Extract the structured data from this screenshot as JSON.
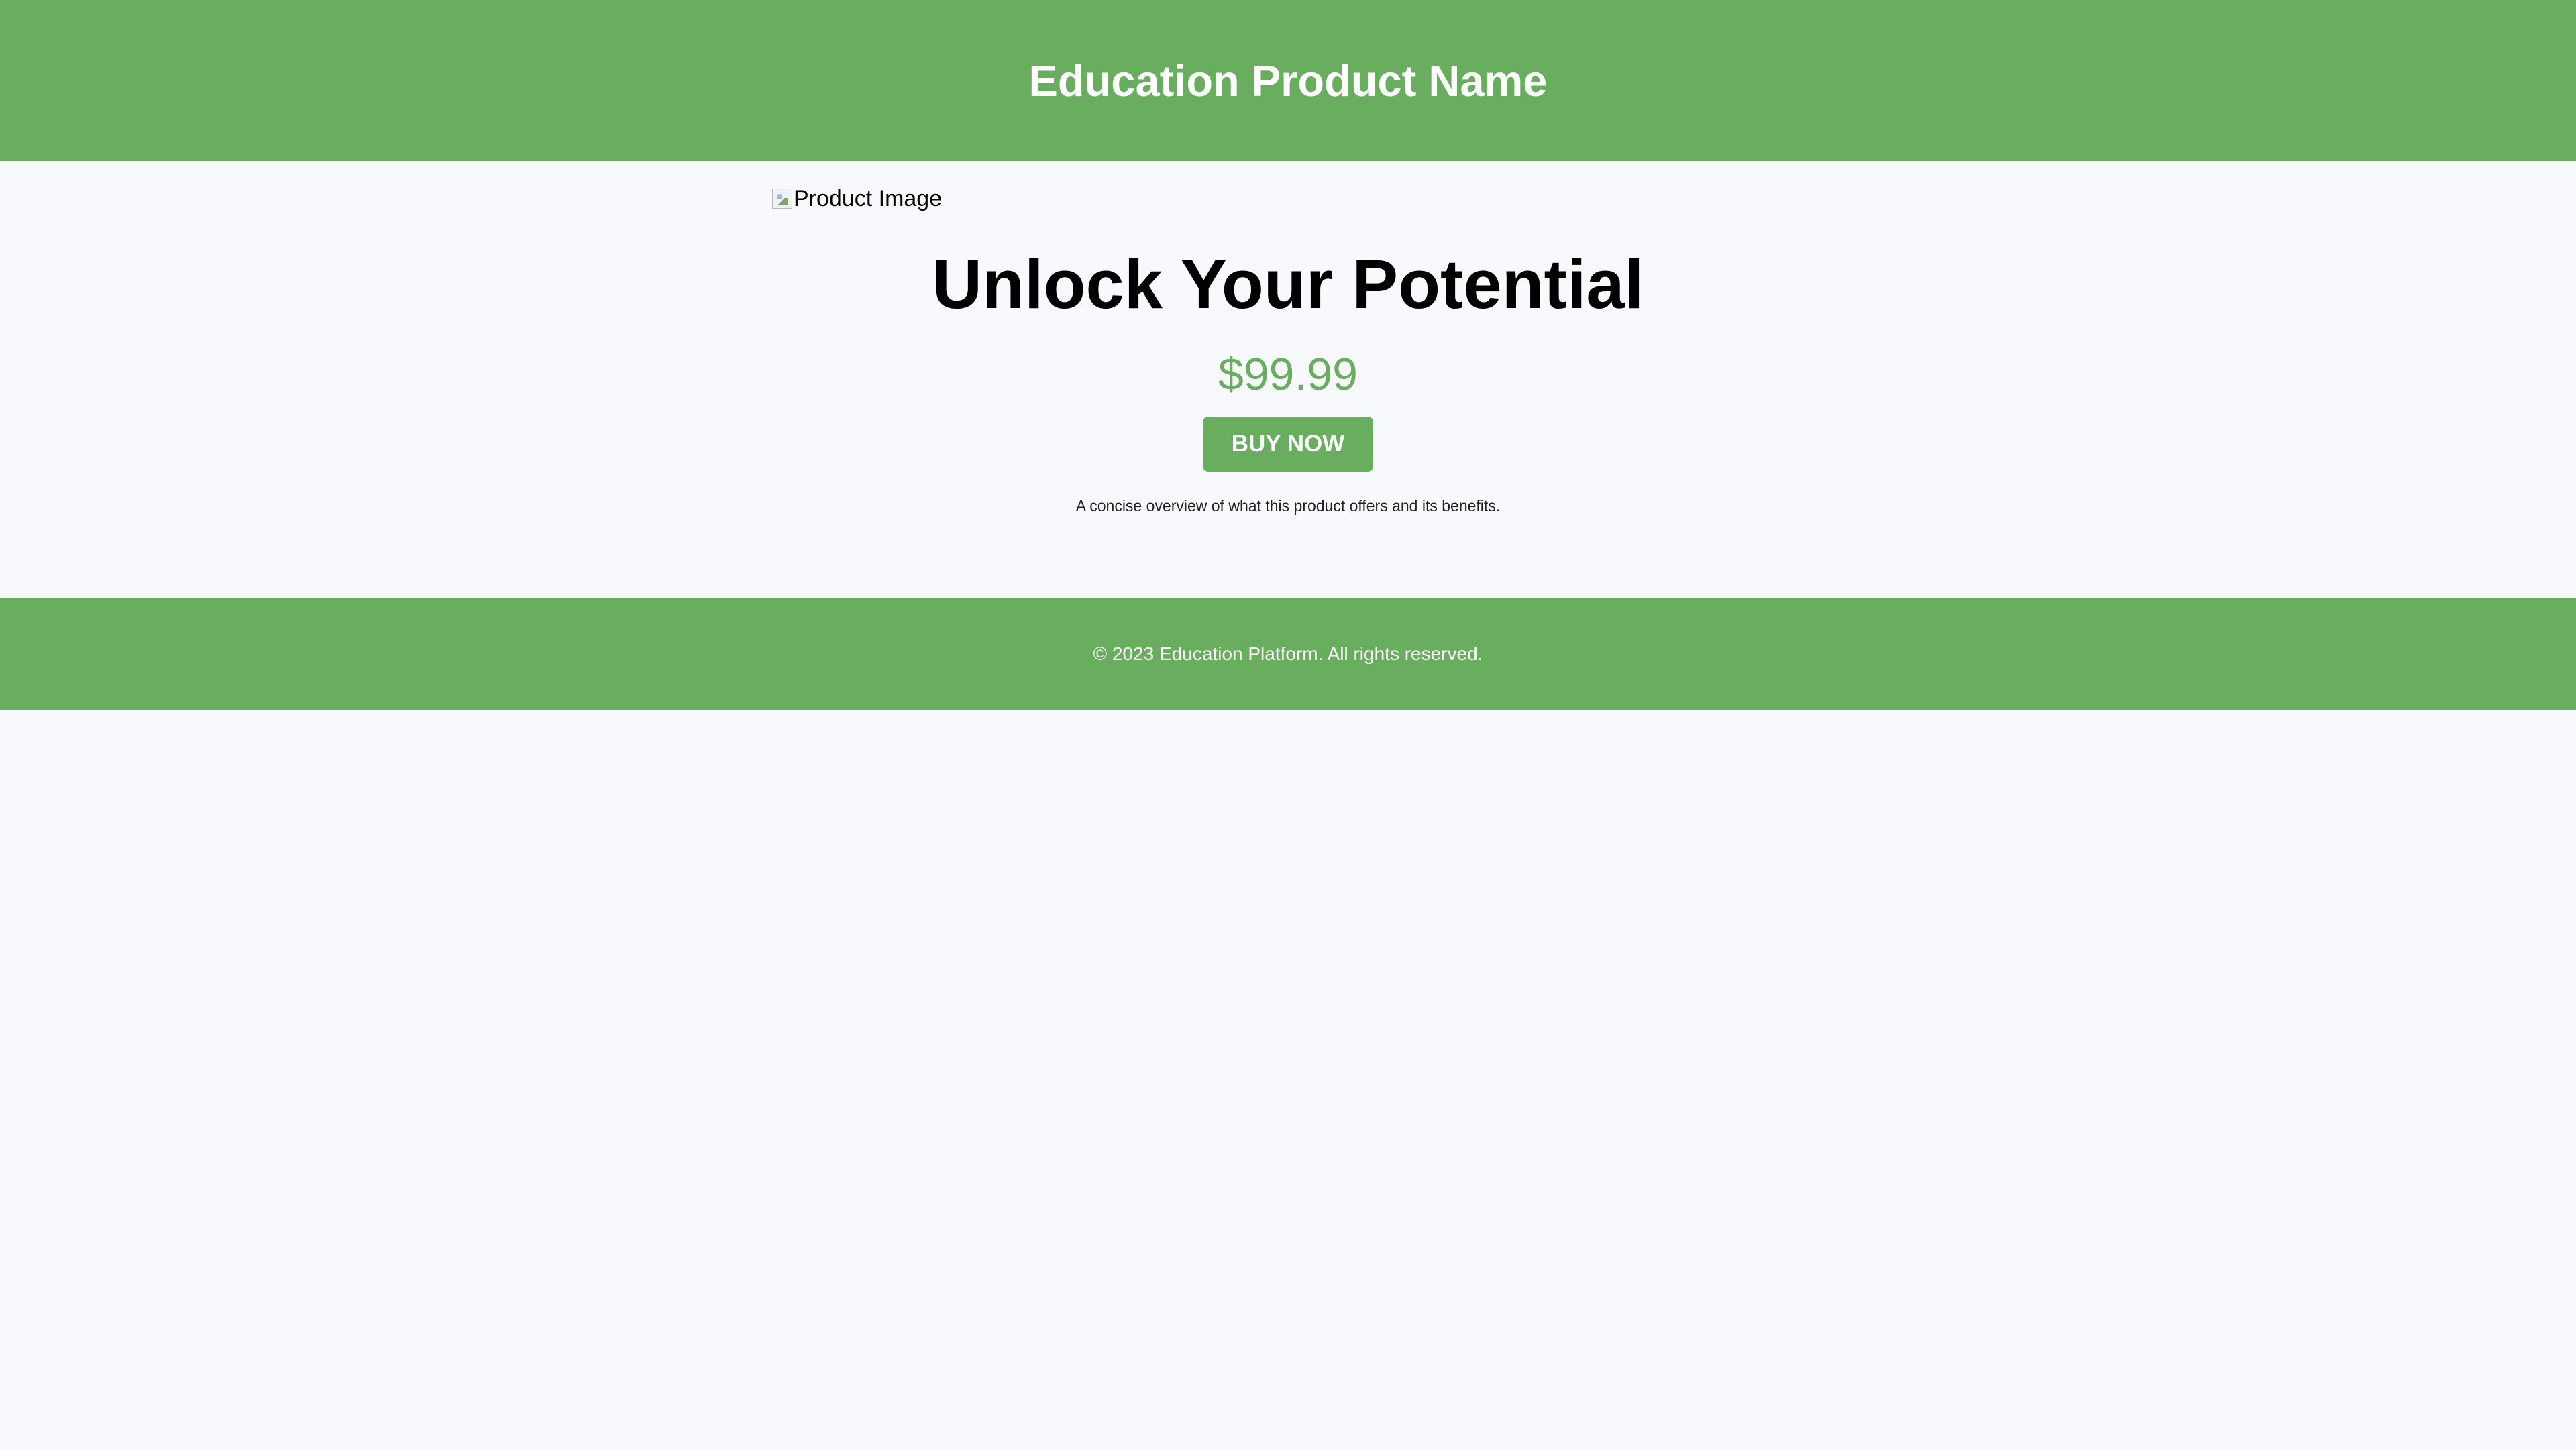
{
  "header": {
    "title": "Education Product Name"
  },
  "main": {
    "image_alt": "Product Image",
    "headline": "Unlock Your Potential",
    "price": "$99.99",
    "buy_button_label": "BUY NOW",
    "description": "A concise overview of what this product offers and its benefits."
  },
  "footer": {
    "copyright": "© 2023 Education Platform. All rights reserved."
  },
  "colors": {
    "brand_green": "#69ae5e",
    "background": "#f7f9fc",
    "text_dark": "#000000",
    "text_light": "#ffffff"
  },
  "icons": {
    "product_image": "broken-image-icon"
  }
}
